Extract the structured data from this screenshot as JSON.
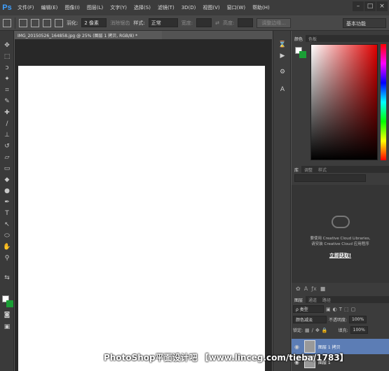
{
  "app": {
    "logo": "Ps"
  },
  "menu": [
    "文件(F)",
    "编辑(E)",
    "图像(I)",
    "图层(L)",
    "文字(Y)",
    "选择(S)",
    "滤镜(T)",
    "3D(D)",
    "视图(V)",
    "窗口(W)",
    "帮助(H)"
  ],
  "window_controls": {
    "minimize": "–",
    "restore": "□",
    "close": "×"
  },
  "options": {
    "feather_label": "羽化:",
    "feather_value": "2 像素",
    "antialias": "消除锯齿",
    "style_label": "样式:",
    "style_value": "正常",
    "width_label": "宽度:",
    "height_label": "高度:",
    "refine_edge": "调整边缘...",
    "workspace": "基本功能"
  },
  "document": {
    "tab": "IMG_20150526_164858.jpg @ 25% (图层 1 拷贝, RGB/8) *"
  },
  "color_panel": {
    "tabs": [
      "颜色",
      "色板"
    ],
    "fg": "#ffffff",
    "bg": "#1a9e35"
  },
  "library_panel": {
    "tabs": [
      "库",
      "调整",
      "样式"
    ],
    "message_line1": "要使用 Creative Cloud Libraries,",
    "message_line2": "请安装 Creative Cloud 应用程序",
    "link": "立即获取!"
  },
  "layers_panel": {
    "tabs": [
      "图层",
      "通道",
      "路径"
    ],
    "filter": "ρ 类型",
    "blend_mode": "颜色减淡",
    "opacity_label": "不透明度:",
    "opacity_value": "100%",
    "lock_label": "锁定:",
    "fill_label": "填充:",
    "fill_value": "100%",
    "layers": [
      {
        "name": "图层 1 拷贝",
        "selected": true
      },
      {
        "name": "图层 1",
        "selected": false
      }
    ]
  },
  "watermark": "PhotoShop平面设计吧 【www.linceg.com/tieba/1783】"
}
